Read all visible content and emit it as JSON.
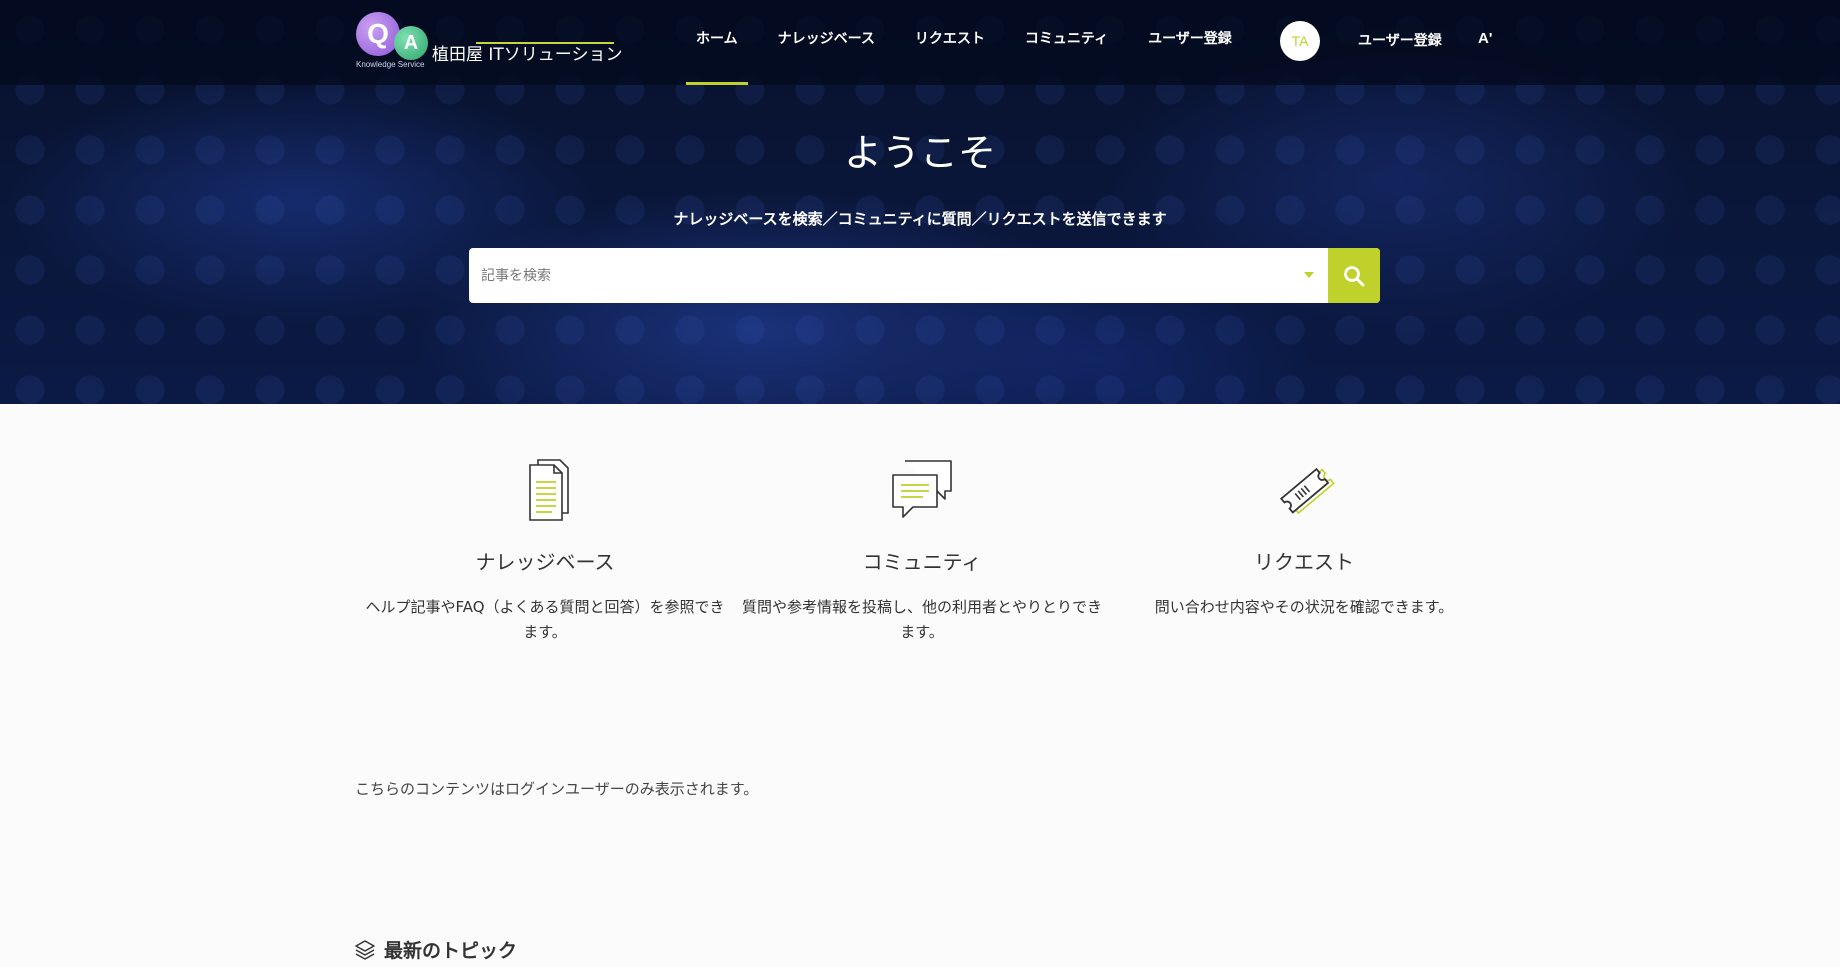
{
  "logo": {
    "q_letter": "Q",
    "a_letter": "A",
    "tagline": "Knowledge Service",
    "brand": "植田屋 ITソリューション"
  },
  "nav": {
    "items": [
      {
        "label": "ホーム",
        "active": true
      },
      {
        "label": "ナレッジベース",
        "active": false
      },
      {
        "label": "リクエスト",
        "active": false
      },
      {
        "label": "コミュニティ",
        "active": false
      },
      {
        "label": "ユーザー登録",
        "active": false
      }
    ],
    "avatar_initials": "TA",
    "user_register": "ユーザー登録",
    "font_size_icon": "A'"
  },
  "hero": {
    "title": "ようこそ",
    "subtitle": "ナレッジベースを検索／コミュニティに質問／リクエストを送信できます"
  },
  "search": {
    "placeholder": "記事を検索",
    "value": ""
  },
  "features": [
    {
      "icon": "documents-icon",
      "title": "ナレッジベース",
      "description": "ヘルプ記事やFAQ（よくある質問と回答）を参照できます。"
    },
    {
      "icon": "chat-bubbles-icon",
      "title": "コミュニティ",
      "description": "質問や参考情報を投稿し、他の利用者とやりとりできます。"
    },
    {
      "icon": "ticket-icon",
      "title": "リクエスト",
      "description": "問い合わせ内容やその状況を確認できます。"
    }
  ],
  "login_note": "こちらのコンテンツはログインユーザーのみ表示されます。",
  "topics": {
    "label": "最新のトピック"
  },
  "colors": {
    "accent": "#c0d12b",
    "header_bg": "#040a1e",
    "hero_bg": "#0b1a45",
    "page_bg": "#fbfbfb"
  }
}
